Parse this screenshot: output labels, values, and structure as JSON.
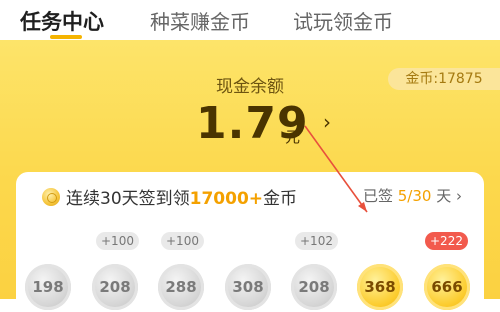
{
  "tabs": [
    {
      "label": "任务中心",
      "active": true
    },
    {
      "label": "种菜赚金币",
      "active": false
    },
    {
      "label": "试玩领金币",
      "active": false
    }
  ],
  "wallet": {
    "coins_label": "金币:17875",
    "cash_label": "现金余额",
    "cash_amount": "1.79",
    "cash_unit": "元"
  },
  "checkin": {
    "title_prefix": "连续30天签到领",
    "title_highlight": "17000+",
    "title_suffix": "金币",
    "status_prefix": "已签",
    "status_value": "5/30",
    "status_suffix": "天 ›",
    "days": [
      {
        "coins": "198",
        "bonus": "",
        "state": "done"
      },
      {
        "coins": "208",
        "bonus": "+100",
        "state": "done"
      },
      {
        "coins": "288",
        "bonus": "+100",
        "state": "done"
      },
      {
        "coins": "308",
        "bonus": "",
        "state": "done"
      },
      {
        "coins": "208",
        "bonus": "+102",
        "state": "done"
      },
      {
        "coins": "368",
        "bonus": "",
        "state": "today"
      },
      {
        "coins": "666",
        "bonus": "+222",
        "state": "upcoming"
      }
    ]
  },
  "colors": {
    "accent": "#f5b400",
    "highlight": "#f4a100",
    "annotation_arrow": "#e8503c"
  }
}
